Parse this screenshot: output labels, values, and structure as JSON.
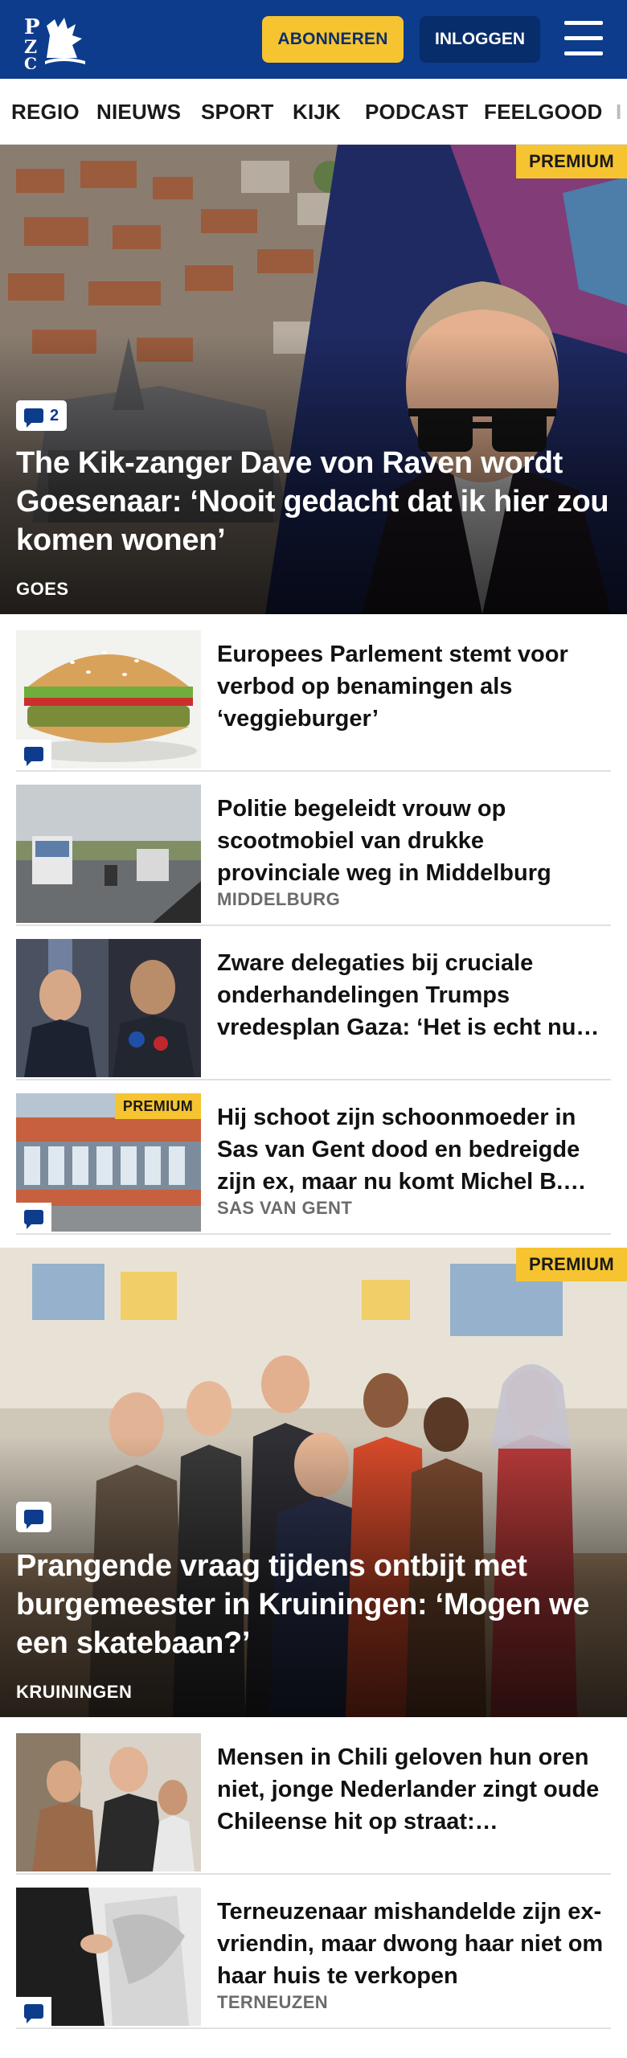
{
  "header": {
    "logo_text": "PZC",
    "subscribe_label": "ABONNEREN",
    "login_label": "INLOGGEN",
    "brand_color": "#0d3c8c",
    "accent_color": "#f6c431"
  },
  "nav": {
    "items": [
      "REGIO",
      "NIEUWS",
      "SPORT",
      "KIJK",
      "PODCAST",
      "FEELGOOD"
    ]
  },
  "hero1": {
    "premium_label": "PREMIUM",
    "comment_count": "2",
    "title": "The Kik-zanger Dave von Raven wordt Goesenaar: ‘Nooit gedacht dat ik hier zou komen wonen’",
    "place": "GOES"
  },
  "articles": [
    {
      "title": "Europees Parlement stemt voor verbod op benamingen als ‘veggieburger’",
      "place": ""
    },
    {
      "title": "Politie begeleidt vrouw op scootmobiel van drukke provinciale weg in Middelburg",
      "place": "MIDDELBURG"
    },
    {
      "title": "Zware delegaties bij cruciale onderhandelingen Trumps vredesplan Gaza: ‘Het is echt nu…",
      "place": ""
    },
    {
      "title": "Hij schoot zijn schoonmoeder in Sas van Gent dood en bedreigde zijn ex, maar nu komt Michel B.…",
      "place": "SAS VAN GENT",
      "premium_label": "PREMIUM"
    }
  ],
  "hero2": {
    "premium_label": "PREMIUM",
    "title": "Prangende vraag tijdens ontbijt met burgemeester in Kruiningen: ‘Mogen we een skatebaan?’",
    "place": "KRUININGEN"
  },
  "articles2": [
    {
      "title": "Mensen in Chili geloven hun oren niet, jonge Nederlander zingt oude Chileense hit op straat:…",
      "place": ""
    },
    {
      "title": "Terneuzenaar mishandelde zijn ex-vriendin, maar dwong haar niet om haar huis te verkopen",
      "place": "TERNEUZEN"
    }
  ]
}
